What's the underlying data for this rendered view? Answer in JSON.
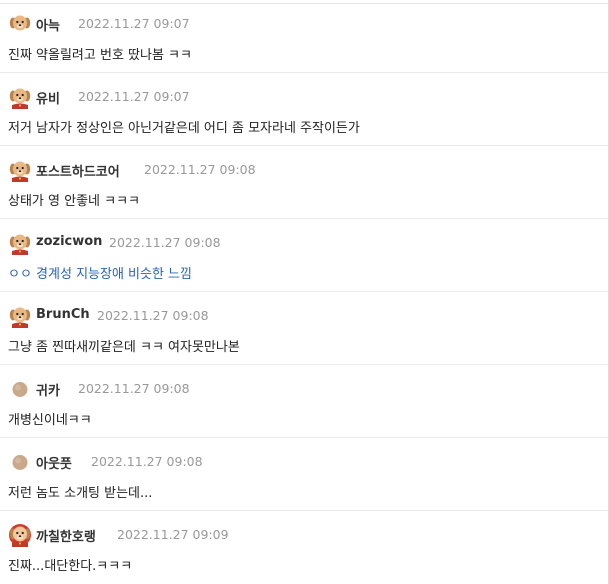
{
  "comments": [
    {
      "nickname": "아늑",
      "date": "2022.11.27 09:07",
      "text": "진짜 약올릴려고 번호 땄나봄 ㅋㅋ",
      "avatar": "puppy-icon",
      "text_style": "normal"
    },
    {
      "nickname": "유비",
      "date": "2022.11.27 09:07",
      "text": "저거 남자가 정상인은 아닌거같은데 어디 좀 모자라네 주작이든가",
      "avatar": "puppy-red-icon",
      "text_style": "normal"
    },
    {
      "nickname": "포스트하드코어",
      "date": "2022.11.27 09:08",
      "text": "상태가 영 안좋네 ㅋㅋㅋ",
      "avatar": "puppy-red-icon",
      "text_style": "normal"
    },
    {
      "nickname": "zozicwon",
      "date": "2022.11.27 09:08",
      "text": "ㅇㅇ 경계성 지능장애 비슷한 느낌",
      "avatar": "puppy-red-icon",
      "text_style": "link"
    },
    {
      "nickname": "BrunCh",
      "date": "2022.11.27 09:08",
      "text": "그냥 좀 찐따새끼같은데 ㅋㅋ 여자못만나본",
      "avatar": "puppy-red-icon",
      "text_style": "normal"
    },
    {
      "nickname": "귀카",
      "date": "2022.11.27 09:08",
      "text": "개병신이네ㅋㅋ",
      "avatar": "circle-avatar-icon",
      "text_style": "normal"
    },
    {
      "nickname": "아웃풋",
      "date": "2022.11.27 09:08",
      "text": "저런 놈도 소개팅 받는데...",
      "avatar": "circle-avatar-icon",
      "text_style": "normal"
    },
    {
      "nickname": "까칠한호랭",
      "date": "2022.11.27 09:09",
      "text": "진짜...대단한다.ㅋㅋㅋ",
      "avatar": "puppy-red-hood-icon",
      "text_style": "normal"
    }
  ],
  "colors": {
    "nickname": "#333333",
    "date": "#999999",
    "text": "#222222",
    "link_text": "#2a62b8",
    "divider": "#e9e9e9"
  }
}
